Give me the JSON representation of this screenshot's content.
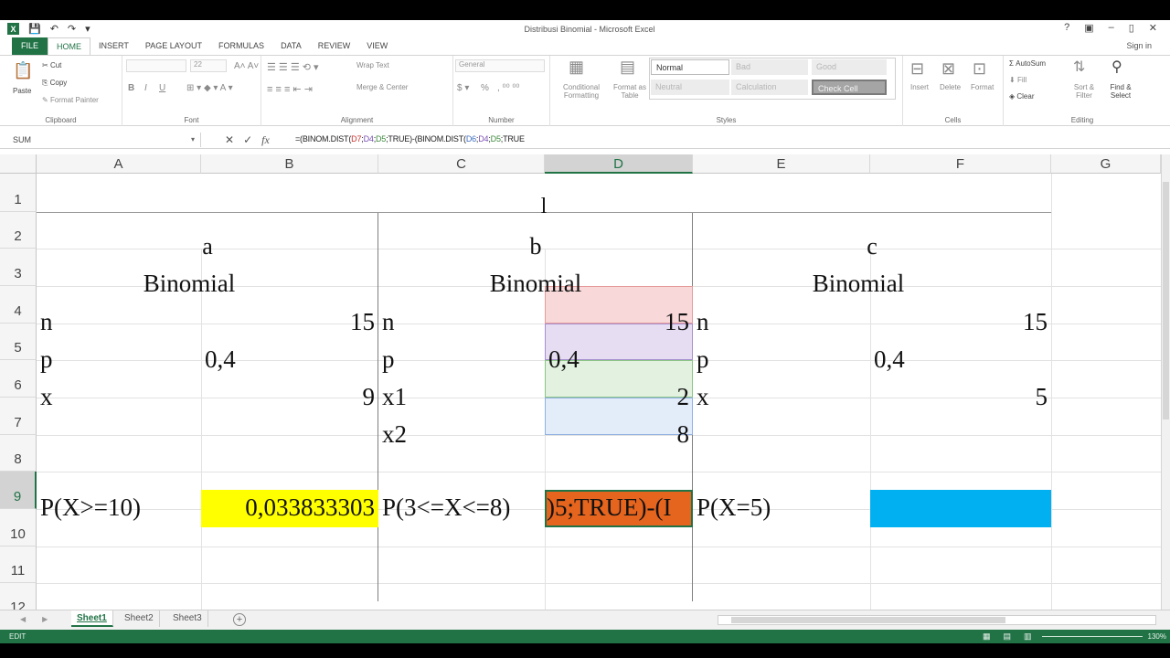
{
  "window": {
    "title": "Distribusi Binomial - Microsoft Excel",
    "controls": [
      "?",
      "▣",
      "–",
      "▯",
      "✕"
    ],
    "signin": "Sign in"
  },
  "ribbon_tabs": [
    "FILE",
    "HOME",
    "INSERT",
    "PAGE LAYOUT",
    "FORMULAS",
    "DATA",
    "REVIEW",
    "VIEW"
  ],
  "active_tab": "HOME",
  "ribbon": {
    "clipboard": {
      "paste": "Paste",
      "cut": "Cut",
      "copy": "Copy",
      "format_painter": "Format Painter",
      "label": "Clipboard"
    },
    "font": {
      "size": "22",
      "label": "Font",
      "bold": "B",
      "italic": "I",
      "underline": "U"
    },
    "alignment": {
      "wrap": "Wrap Text",
      "merge": "Merge & Center",
      "label": "Alignment"
    },
    "number": {
      "format": "General",
      "label": "Number",
      "percent": "%"
    },
    "styles": {
      "conditional": "Conditional Formatting",
      "format_table": "Format as Table",
      "normal": "Normal",
      "bad": "Bad",
      "good": "Good",
      "neutral": "Neutral",
      "calculation": "Calculation",
      "check_cell": "Check Cell",
      "label": "Styles"
    },
    "cells": {
      "insert": "Insert",
      "delete": "Delete",
      "format": "Format",
      "label": "Cells"
    },
    "editing": {
      "autosum": "AutoSum",
      "fill": "Fill",
      "clear": "Clear",
      "sort": "Sort & Filter",
      "find": "Find & Select",
      "label": "Editing"
    }
  },
  "formula_bar": {
    "name_box": "SUM",
    "formula_parts": [
      "=(BINOM.DIST(",
      "D7",
      ";",
      "D4",
      ";",
      "D5",
      ";TRUE)-(BINOM.DIST(",
      "D6",
      ";",
      "D4",
      ";",
      "D5",
      ";TRUE"
    ]
  },
  "columns": [
    "A",
    "B",
    "C",
    "D",
    "E",
    "F",
    "G"
  ],
  "selected_column": "D",
  "rows": [
    "1",
    "2",
    "3",
    "4",
    "5",
    "6",
    "7",
    "8",
    "9",
    "10",
    "11",
    "12"
  ],
  "selected_row": "9",
  "cells": {
    "title": "l",
    "a_header": "a",
    "b_header": "b",
    "c_header": "c",
    "a_binomial": "Binomial",
    "b_binomial": "Binomial",
    "c_binomial": "Binomial",
    "A4": "n",
    "B4": "15",
    "A5": "p",
    "B5": "0,4",
    "A6": "x",
    "B6": "9",
    "C4": "n",
    "D4": "15",
    "C5": "p",
    "D5": "0,4",
    "C6": "x1",
    "D6": "2",
    "C7": "x2",
    "D7": "8",
    "E4": "n",
    "F4": "15",
    "E5": "p",
    "F5": "0,4",
    "E6": "x",
    "F6": "5",
    "A9": "P(X>=10)",
    "B9": "0,033833303",
    "C9": "P(3<=X<=8)",
    "D9": ")5;TRUE)-(I",
    "E9": "P(X=5)",
    "F9": ""
  },
  "colors": {
    "excel_green": "#217346",
    "yellow_fill": "#FFFF00",
    "orange_fill": "#E5641E",
    "blue_fill": "#00B0F0",
    "d4_fill": "#F8D8D8",
    "d5_fill": "#E6DDF2",
    "d6_fill": "#E3F1E0",
    "d7_fill": "#E3ECF9"
  },
  "sheets": [
    "Sheet1",
    "Sheet2",
    "Sheet3"
  ],
  "active_sheet": "Sheet1",
  "status": {
    "mode": "EDIT",
    "zoom": "130%"
  }
}
